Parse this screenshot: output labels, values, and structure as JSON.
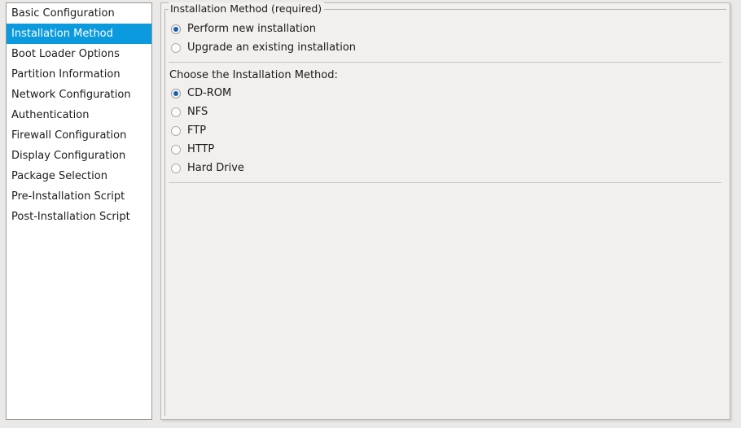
{
  "sidebar": {
    "selected_index": 1,
    "items": [
      {
        "label": "Basic Configuration"
      },
      {
        "label": "Installation Method"
      },
      {
        "label": "Boot Loader Options"
      },
      {
        "label": "Partition Information"
      },
      {
        "label": "Network Configuration"
      },
      {
        "label": "Authentication"
      },
      {
        "label": "Firewall Configuration"
      },
      {
        "label": "Display Configuration"
      },
      {
        "label": "Package Selection"
      },
      {
        "label": "Pre-Installation Script"
      },
      {
        "label": "Post-Installation Script"
      }
    ]
  },
  "content": {
    "group_legend": "Installation Method (required)",
    "install_type": {
      "options": [
        {
          "label": "Perform new installation",
          "checked": true
        },
        {
          "label": "Upgrade an existing installation",
          "checked": false
        }
      ]
    },
    "method_heading": "Choose the Installation Method:",
    "method": {
      "options": [
        {
          "label": "CD-ROM",
          "checked": true
        },
        {
          "label": "NFS",
          "checked": false
        },
        {
          "label": "FTP",
          "checked": false
        },
        {
          "label": "HTTP",
          "checked": false
        },
        {
          "label": "Hard Drive",
          "checked": false
        }
      ]
    }
  },
  "colors": {
    "selection_blue": "#0c9ade",
    "radio_dot": "#1a5fb4",
    "panel_bg": "#f2f0ef",
    "window_bg": "#ebe9e7",
    "list_bg": "#ffffff",
    "border": "#b4b0ac"
  }
}
